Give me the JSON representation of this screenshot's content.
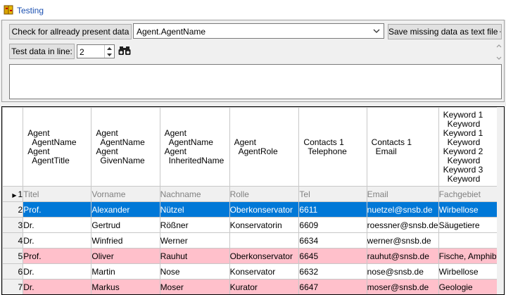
{
  "window": {
    "title": "Testing",
    "icon": "app-book-icon"
  },
  "toolbar": {
    "check_label": "Check for allready present data",
    "combo_value": "Agent.AgentName",
    "save_label": "Save missing data as text file",
    "save_icon": "floppy-disk-icon",
    "testline_label": "Test data in line:",
    "line_value": "2",
    "find_icon": "binoculars-icon"
  },
  "grid": {
    "headers": [
      {
        "lines": [
          "Agent",
          "  AgentName",
          "Agent",
          "  AgentTitle"
        ]
      },
      {
        "lines": [
          "Agent",
          "  AgentName",
          "Agent",
          "  GivenName"
        ]
      },
      {
        "lines": [
          "Agent",
          "  AgentName",
          "Agent",
          "  InheritedName"
        ]
      },
      {
        "lines": [
          "Agent",
          "  AgentRole"
        ]
      },
      {
        "lines": [
          "Contacts 1",
          "  Telephone"
        ]
      },
      {
        "lines": [
          "Contacts 1",
          "  Email"
        ]
      },
      {
        "lines": [
          "Keyword 1",
          "  Keyword",
          "Keyword 1",
          "  Keyword",
          "Keyword 2",
          "  Keyword",
          "Keyword 3",
          "  Keyword"
        ]
      }
    ],
    "rows": [
      {
        "num": "1",
        "style": "sub",
        "cells": [
          "Titel",
          "Vorname",
          "Nachname",
          "Rolle",
          "Tel",
          "Email",
          "Fachgebiet"
        ]
      },
      {
        "num": "2",
        "style": "sel",
        "cells": [
          "Prof.",
          "Alexander",
          "Nützel",
          "Oberkonservator",
          "6611",
          "nuetzel@snsb.de",
          "Wirbellose"
        ]
      },
      {
        "num": "3",
        "style": "",
        "cells": [
          "Dr.",
          "Gertrud",
          "Rößner",
          "Konservatorin",
          "6609",
          "roessner@snsb.de",
          "Säugetiere"
        ]
      },
      {
        "num": "4",
        "style": "",
        "cells": [
          "Dr.",
          "Winfried",
          "Werner",
          "",
          "6634",
          "werner@snsb.de",
          ""
        ]
      },
      {
        "num": "5",
        "style": "pink",
        "cells": [
          "Prof.",
          "Oliver",
          "Rauhut",
          "Oberkonservator",
          "6645",
          "rauhut@snsb.de",
          "Fische, Amphibie"
        ]
      },
      {
        "num": "6",
        "style": "",
        "cells": [
          "Dr.",
          "Martin",
          "Nose",
          "Konservator",
          "6632",
          "nose@snsb.de",
          "Wirbellose"
        ]
      },
      {
        "num": "7",
        "style": "pink",
        "cells": [
          "Dr.",
          "Markus",
          "Moser",
          "Kurator",
          "6647",
          "moser@snsb.de",
          "Geologie"
        ]
      }
    ]
  },
  "colors": {
    "selection": "#0078d7",
    "highlight": "#ffc0cb",
    "title": "#1a4fb0"
  }
}
